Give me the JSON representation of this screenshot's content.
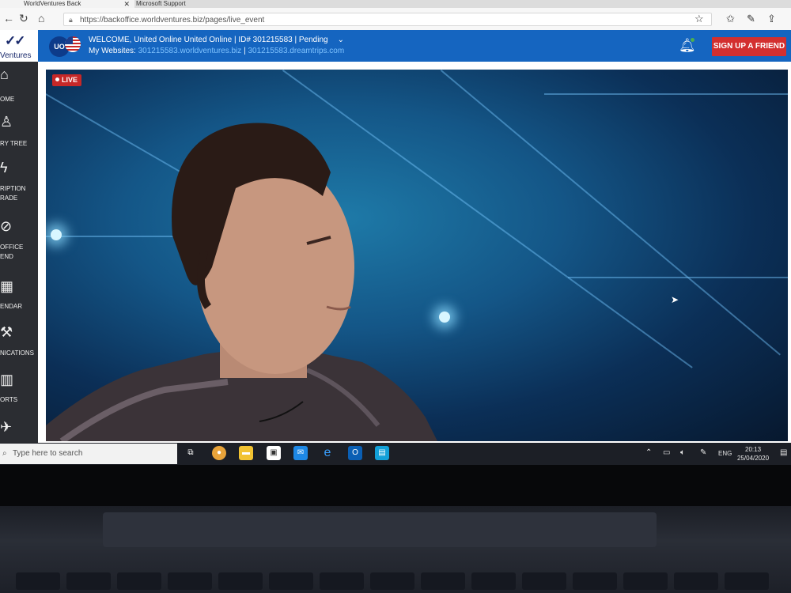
{
  "browser": {
    "tabs": [
      {
        "label": "WorldVentures Back"
      },
      {
        "label": "Microsoft Support"
      }
    ],
    "url": "https://backoffice.worldventures.biz/pages/live_event"
  },
  "brand": {
    "logo_text": "Ventures"
  },
  "header": {
    "avatar_initials": "UO",
    "welcome": "WELCOME, United Online United Online | ID# 301215583 | Pending",
    "websites_label": "My Websites:",
    "website1": "301215583.worldventures.biz",
    "separator": "|",
    "website2": "301215583.dreamtrips.com",
    "signup_label": "SIGN UP A FRIEND"
  },
  "sidebar": {
    "items": [
      {
        "icon": "home-icon",
        "label": "OME"
      },
      {
        "icon": "person-icon",
        "label": "RY TREE"
      },
      {
        "icon": "bolt-icon",
        "label": "RIPTION\nRADE"
      },
      {
        "icon": "compass-icon",
        "label": "OFFICE\nEND"
      },
      {
        "icon": "calendar-icon",
        "label": "ENDAR"
      },
      {
        "icon": "wrench-icon",
        "label": "NICATIONS"
      },
      {
        "icon": "chart-icon",
        "label": "ORTS"
      }
    ]
  },
  "video": {
    "live_label": "LIVE"
  },
  "taskbar": {
    "search_placeholder": "Type here to search",
    "language": "ENG",
    "time": "20:13",
    "date": "25/04/2020"
  },
  "colors": {
    "header_blue": "#1565c0",
    "signup_red": "#d32f2f",
    "live_red": "#c62828",
    "sidebar_dark": "#2b2d32",
    "link_blue": "#7fc3ff"
  }
}
